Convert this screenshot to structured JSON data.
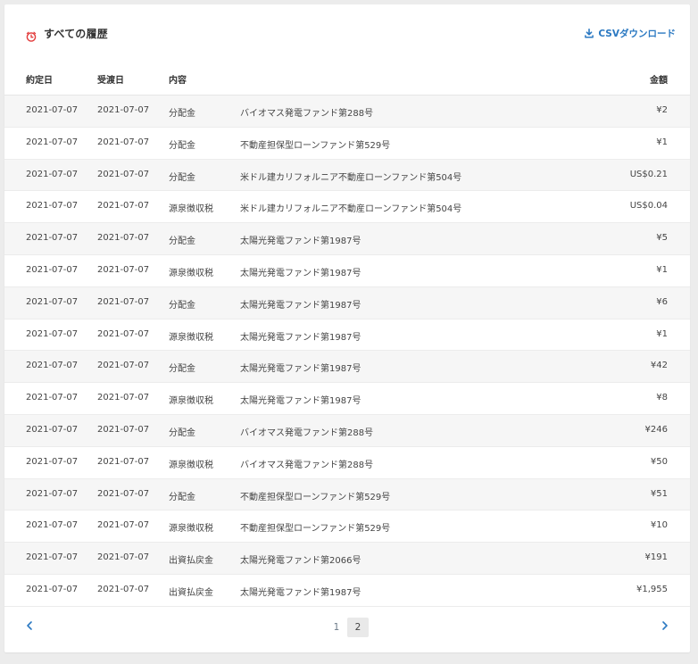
{
  "header": {
    "title": "すべての履歴",
    "csv_label": "CSVダウンロード",
    "icons": {
      "title": "clock-icon",
      "csv": "download-icon"
    },
    "colors": {
      "clock": "#e23a3a",
      "link": "#2b79c2"
    }
  },
  "table": {
    "columns": [
      "約定日",
      "受渡日",
      "内容",
      "",
      "金額"
    ],
    "rows": [
      [
        "2021-07-07",
        "2021-07-07",
        "分配金",
        "バイオマス発電ファンド第288号",
        "¥2"
      ],
      [
        "2021-07-07",
        "2021-07-07",
        "分配金",
        "不動産担保型ローンファンド第529号",
        "¥1"
      ],
      [
        "2021-07-07",
        "2021-07-07",
        "分配金",
        "米ドル建カリフォルニア不動産ローンファンド第504号",
        "US$0.21"
      ],
      [
        "2021-07-07",
        "2021-07-07",
        "源泉徴収税",
        "米ドル建カリフォルニア不動産ローンファンド第504号",
        "US$0.04"
      ],
      [
        "2021-07-07",
        "2021-07-07",
        "分配金",
        "太陽光発電ファンド第1987号",
        "¥5"
      ],
      [
        "2021-07-07",
        "2021-07-07",
        "源泉徴収税",
        "太陽光発電ファンド第1987号",
        "¥1"
      ],
      [
        "2021-07-07",
        "2021-07-07",
        "分配金",
        "太陽光発電ファンド第1987号",
        "¥6"
      ],
      [
        "2021-07-07",
        "2021-07-07",
        "源泉徴収税",
        "太陽光発電ファンド第1987号",
        "¥1"
      ],
      [
        "2021-07-07",
        "2021-07-07",
        "分配金",
        "太陽光発電ファンド第1987号",
        "¥42"
      ],
      [
        "2021-07-07",
        "2021-07-07",
        "源泉徴収税",
        "太陽光発電ファンド第1987号",
        "¥8"
      ],
      [
        "2021-07-07",
        "2021-07-07",
        "分配金",
        "バイオマス発電ファンド第288号",
        "¥246"
      ],
      [
        "2021-07-07",
        "2021-07-07",
        "源泉徴収税",
        "バイオマス発電ファンド第288号",
        "¥50"
      ],
      [
        "2021-07-07",
        "2021-07-07",
        "分配金",
        "不動産担保型ローンファンド第529号",
        "¥51"
      ],
      [
        "2021-07-07",
        "2021-07-07",
        "源泉徴収税",
        "不動産担保型ローンファンド第529号",
        "¥10"
      ],
      [
        "2021-07-07",
        "2021-07-07",
        "出資払戻金",
        "太陽光発電ファンド第2066号",
        "¥191"
      ],
      [
        "2021-07-07",
        "2021-07-07",
        "出資払戻金",
        "太陽光発電ファンド第1987号",
        "¥1,955"
      ]
    ]
  },
  "pagination": {
    "pages": [
      "1",
      "2"
    ],
    "current": "2",
    "icons": {
      "prev": "chevron-left-icon",
      "next": "chevron-right-icon"
    }
  }
}
